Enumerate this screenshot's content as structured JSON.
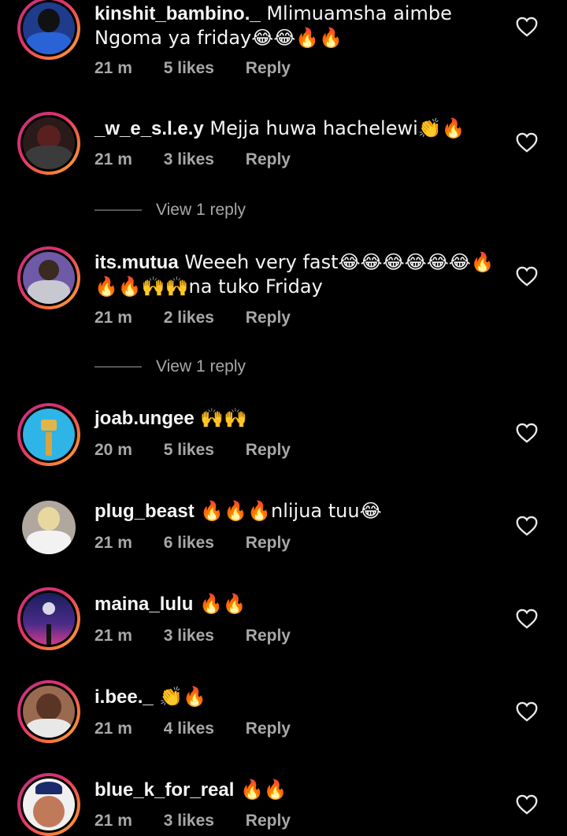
{
  "comments": [
    {
      "username": "kinshit_bambino._",
      "text": " Mlimuamsha aimbe Ngoma ya friday😂😂🔥🔥",
      "time": "21 m",
      "likes": "5 likes",
      "reply": "Reply"
    },
    {
      "username": "_w_e_s.l.e.y",
      "text": " Mejja huwa hachelewi👏🔥",
      "time": "21 m",
      "likes": "3 likes",
      "reply": "Reply"
    },
    {
      "username": "its.mutua",
      "text": " Weeeh very fast😂😂😂😂😂😂🔥🔥🔥🙌🙌na tuko Friday",
      "time": "21 m",
      "likes": "2 likes",
      "reply": "Reply"
    },
    {
      "username": "joab.ungee",
      "text": " 🙌🙌",
      "time": "20 m",
      "likes": "5 likes",
      "reply": "Reply"
    },
    {
      "username": "plug_beast",
      "text": " 🔥🔥🔥nlijua tuu😂",
      "time": "21 m",
      "likes": "6 likes",
      "reply": "Reply"
    },
    {
      "username": "maina_lulu",
      "text": " 🔥🔥",
      "time": "21 m",
      "likes": "3 likes",
      "reply": "Reply"
    },
    {
      "username": "i.bee._",
      "text": " 👏🔥",
      "time": "21 m",
      "likes": "4 likes",
      "reply": "Reply"
    },
    {
      "username": "blue_k_for_real",
      "text": " 🔥🔥",
      "time": "21 m",
      "likes": "3 likes",
      "reply": "Reply"
    }
  ],
  "view_replies": [
    "View 1 reply",
    "View 1 reply"
  ],
  "colors": {
    "background": "#000000",
    "text": "#f5f5f5",
    "muted": "#a8a8a8"
  }
}
